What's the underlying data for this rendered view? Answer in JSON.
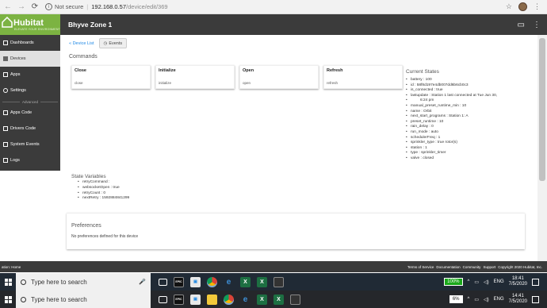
{
  "browser": {
    "security": "Not secure",
    "host": "192.168.0.57",
    "path": "/device/edit/369"
  },
  "app": {
    "logo_text": "Hubitat",
    "logo_tag": "ELEVATE YOUR ENVIRONMENT",
    "device_title": "Bhyve Zone 1",
    "brand_color": "#7cb342",
    "header_color": "#3b3b3b"
  },
  "sidebar": {
    "items": [
      {
        "label": "Dashboards",
        "icon": "dashboard-icon"
      },
      {
        "label": "Devices",
        "icon": "device-icon"
      },
      {
        "label": "Apps",
        "icon": "apps-icon"
      },
      {
        "label": "Settings",
        "icon": "gear-icon"
      }
    ],
    "divider": "Advanced",
    "advanced_items": [
      {
        "label": "Apps Code",
        "icon": "code-icon"
      },
      {
        "label": "Drivers Code",
        "icon": "code-icon"
      },
      {
        "label": "System Events",
        "icon": "list-icon"
      },
      {
        "label": "Logs",
        "icon": "logs-icon"
      }
    ]
  },
  "main": {
    "crumb": "« Device List",
    "events_button": "Events",
    "commands_title": "Commands",
    "commands": [
      {
        "name": "Close",
        "sub": "close"
      },
      {
        "name": "Initialize",
        "sub": "initialize"
      },
      {
        "name": "Open",
        "sub": "open"
      },
      {
        "name": "Refresh",
        "sub": "refresh"
      }
    ],
    "current_states_title": "Current States",
    "current_states": [
      "battery : 100",
      "id : 58f8d197e4db007dd6b6cb0c3",
      "is_connected : true",
      "lastupdate : Station 1 last connected at Tue Jun 30,",
      "6:24 pm",
      "manual_preset_runtime_min : 10",
      "name : Orbit",
      "next_start_programs : Station 1: A",
      "preset_runtime : 10",
      "rain_delay : 0",
      "run_mode : auto",
      "schedulerFreq : 1",
      "sprinkler_type : true rotor(s)",
      "station : 1",
      "type : sprinkler_timer",
      "valve : closed"
    ],
    "state_vars_title": "State Variables",
    "state_vars": [
      "retryCommand :",
      "websocketOpen : true",
      "retryCount : 0",
      "nextRetry : 1592884841299"
    ],
    "prefs_title": "Preferences",
    "prefs_text": "No preferences defined for this device"
  },
  "footer": {
    "location": "ation: Home",
    "links": [
      "Terms of Service",
      "Documentation",
      "Community",
      "Support",
      "Copyright 2020 Hubitat, Inc."
    ]
  },
  "taskbar1": {
    "search_placeholder": "Type here to search",
    "battery": "100%",
    "lang": "ENG",
    "time": "18:41",
    "date": "7/5/2020"
  },
  "taskbar2": {
    "search_placeholder": "Type here to search",
    "battery": "6%",
    "lang": "ENG",
    "time": "14:41",
    "date": "7/5/2020"
  }
}
